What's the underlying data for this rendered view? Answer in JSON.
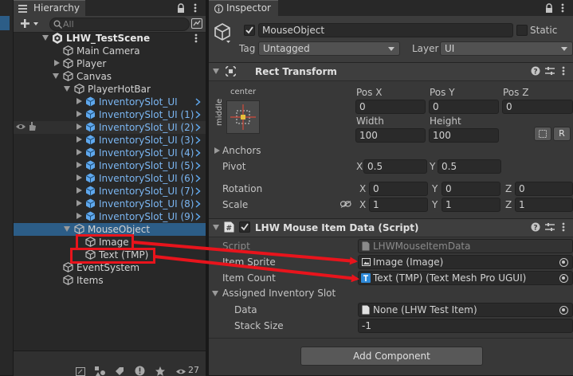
{
  "hierarchy": {
    "tab_title": "Hierarchy",
    "search_placeholder": "All",
    "scene_name": "LHW_TestScene",
    "rows": [
      {
        "label": "Main Camera"
      },
      {
        "label": "Player"
      },
      {
        "label": "Canvas"
      },
      {
        "label": "PlayerHotBar"
      },
      {
        "label": "InventorySlot_UI"
      },
      {
        "label": "InventorySlot_UI (1)"
      },
      {
        "label": "InventorySlot_UI (2)"
      },
      {
        "label": "InventorySlot_UI (3)"
      },
      {
        "label": "InventorySlot_UI (4)"
      },
      {
        "label": "InventorySlot_UI (5)"
      },
      {
        "label": "InventorySlot_UI (6)"
      },
      {
        "label": "InventorySlot_UI (7)"
      },
      {
        "label": "InventorySlot_UI (8)"
      },
      {
        "label": "InventorySlot_UI (9)"
      },
      {
        "label": "MouseObject"
      },
      {
        "label": "Image"
      },
      {
        "label": "Text (TMP)"
      },
      {
        "label": "EventSystem"
      },
      {
        "label": "Items"
      }
    ],
    "bottom_count": "27"
  },
  "inspector": {
    "tab_title": "Inspector",
    "object_name": "MouseObject",
    "static_label": "Static",
    "tag_label": "Tag",
    "tag_value": "Untagged",
    "layer_label": "Layer",
    "layer_value": "UI",
    "rect_transform": {
      "title": "Rect Transform",
      "anchor_preset_top": "center",
      "anchor_preset_side": "middle",
      "pos_x_label": "Pos X",
      "pos_x": "0",
      "pos_y_label": "Pos Y",
      "pos_y": "0",
      "pos_z_label": "Pos Z",
      "pos_z": "0",
      "width_label": "Width",
      "width": "100",
      "height_label": "Height",
      "height": "100",
      "raw_button": "R",
      "anchors_label": "Anchors",
      "pivot_label": "Pivot",
      "pivot_x": "0.5",
      "pivot_y": "0.5",
      "rotation_label": "Rotation",
      "rot_x": "0",
      "rot_y": "0",
      "rot_z": "0",
      "scale_label": "Scale",
      "scale_x": "1",
      "scale_y": "1",
      "scale_z": "1",
      "x": "X",
      "y": "Y",
      "z": "Z"
    },
    "script_component": {
      "title": "LHW Mouse Item Data (Script)",
      "script_label": "Script",
      "script_value": "LHWMouseItemData",
      "item_sprite_label": "Item Sprite",
      "item_sprite_value": "Image (Image)",
      "item_count_label": "Item Count",
      "item_count_value": "Text (TMP) (Text Mesh Pro UGUI)",
      "assigned_slot_label": "Assigned Inventory Slot",
      "data_label": "Data",
      "data_value": "None (LHW Test Item)",
      "stack_size_label": "Stack Size",
      "stack_size_value": "-1"
    },
    "add_component": "Add Component"
  },
  "colors": {
    "selection": "#2c5d87",
    "prefab_text": "#7bb6f2",
    "annotation_red": "#e8141c"
  }
}
